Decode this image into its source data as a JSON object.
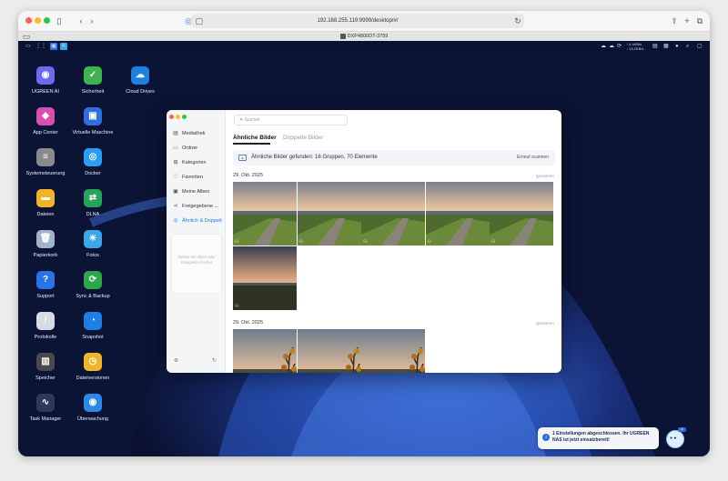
{
  "browser": {
    "url": "192.168.255.119:9999/desktop/#/",
    "tab_title": "DXP4800DT-3759",
    "icons": [
      "sidebar-icon",
      "back-icon",
      "forward-icon",
      "shield-icon",
      "bitwarden-icon",
      "extension-icon",
      "share-icon",
      "new-tab-icon",
      "tabs-icon",
      "reload-icon"
    ]
  },
  "desktop": {
    "status": {
      "net_up": "↑ 4.4KB/s",
      "net_down": "↓ 13.2KB/s"
    },
    "icons": [
      {
        "label": "UGREEN AI",
        "icon": "ai-icon",
        "color": "#6a6cf0",
        "glyph": "◉"
      },
      {
        "label": "Sicherheit",
        "icon": "security-icon",
        "color": "#3fb34f",
        "glyph": "✓"
      },
      {
        "label": "Cloud Drives",
        "icon": "cloud-drives-icon",
        "color": "#1e7fe0",
        "glyph": "☁"
      },
      {
        "label": "App Center",
        "icon": "app-center-icon",
        "color": "#d94fb0",
        "glyph": "◆"
      },
      {
        "label": "Virtuelle Maschine",
        "icon": "vm-icon",
        "color": "#2d6fe0",
        "glyph": "▣"
      },
      {
        "label": "Systemsteuerung",
        "icon": "control-panel-icon",
        "color": "#8a8a8a",
        "glyph": "≡"
      },
      {
        "label": "Docker",
        "icon": "docker-icon",
        "color": "#2a9df4",
        "glyph": "◎"
      },
      {
        "label": "Dateien",
        "icon": "files-icon",
        "color": "#f0b429",
        "glyph": "▬"
      },
      {
        "label": "DLNA",
        "icon": "dlna-icon",
        "color": "#27a35a",
        "glyph": "⇄"
      },
      {
        "label": "Papierkorb",
        "icon": "trash-icon",
        "color": "#9fb4c6",
        "glyph": "🗑"
      },
      {
        "label": "Fotos",
        "icon": "photos-icon",
        "color": "#39a7e8",
        "glyph": "☀"
      },
      {
        "label": "Support",
        "icon": "support-icon",
        "color": "#2a72e8",
        "glyph": "?"
      },
      {
        "label": "Sync & Backup",
        "icon": "sync-backup-icon",
        "color": "#2aa84a",
        "glyph": "⟳"
      },
      {
        "label": "Protokolle",
        "icon": "logs-icon",
        "color": "#d7dbe3",
        "glyph": "/"
      },
      {
        "label": "Snapshot",
        "icon": "snapshot-icon",
        "color": "#1c7fe6",
        "glyph": "◔"
      },
      {
        "label": "Speicher",
        "icon": "storage-icon",
        "color": "#4a4a4a",
        "glyph": "▥"
      },
      {
        "label": "Dateiversionen",
        "icon": "file-versions-icon",
        "color": "#f1b52a",
        "glyph": "◷"
      },
      {
        "label": "Task Manager",
        "icon": "task-manager-icon",
        "color": "#2b3a5a",
        "glyph": "∿"
      },
      {
        "label": "Überwachung",
        "icon": "surveillance-icon",
        "color": "#2a8ae8",
        "glyph": "◉"
      }
    ]
  },
  "photos_app": {
    "search_placeholder": "Suchen",
    "sidebar": [
      {
        "label": "Mediathek",
        "icon": "media-library-icon",
        "glyph": "▤"
      },
      {
        "label": "Ordner",
        "icon": "folder-icon",
        "glyph": "▭"
      },
      {
        "label": "Kategorien",
        "icon": "categories-icon",
        "glyph": "⊞"
      },
      {
        "label": "Favoriten",
        "icon": "heart-icon",
        "glyph": "♡"
      },
      {
        "label": "Meine Alben",
        "icon": "albums-icon",
        "glyph": "▣"
      },
      {
        "label": "Freigegebene ...",
        "icon": "shared-icon",
        "glyph": "⋖"
      },
      {
        "label": "Ähnlich & Doppelt",
        "icon": "similar-duplicate-icon",
        "glyph": "◎"
      }
    ],
    "hint": "Ziehen Sie Alben oder Kategorien hierher",
    "tabs": [
      "Ähnliche Bilder",
      "Doppelte Bilder"
    ],
    "banner": {
      "text": "Ähnliche Bilder gefunden: 16 Gruppen, 70 Elemente",
      "button": "Erneut scannen"
    },
    "groups": [
      {
        "date": "29. Okt. 2025",
        "ignore": "Ignorieren",
        "photos": [
          "field",
          "field",
          "field",
          "field",
          "field",
          "sunset"
        ]
      },
      {
        "date": "29. Okt. 2025",
        "ignore": "Ignorieren",
        "photos": [
          "tree",
          "tree",
          "tree"
        ]
      }
    ]
  },
  "toast": {
    "text": "1 Einstellungen abgeschlossen. Ihr UGREEN NAS ist jetzt einsatzbereit!"
  }
}
